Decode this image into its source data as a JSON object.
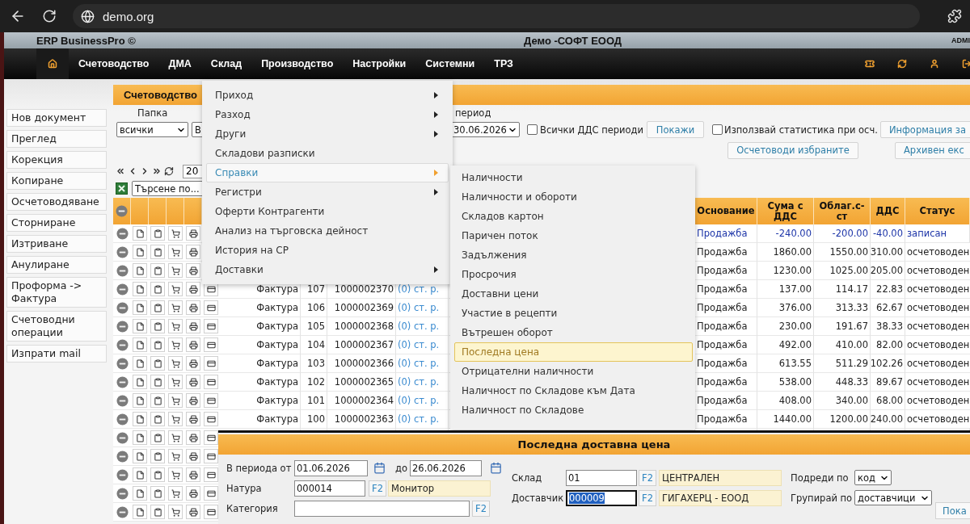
{
  "browser": {
    "url": "demo.org"
  },
  "app": {
    "name": "ERP BusinessPro ©",
    "company": "Демо -СОФТ ЕООД",
    "user": "ADMI"
  },
  "nav": {
    "items": [
      "Счетоводство",
      "ДМА",
      "Склад",
      "Производство",
      "Настройки",
      "Системни",
      "ТРЗ"
    ]
  },
  "sidebar": {
    "items": [
      "Нов документ",
      "Преглед",
      "Корекция",
      "Копиране",
      "Осчетоводяване",
      "Сторниране",
      "Изтриване",
      "Анулиране",
      "Проформа -> Фактура",
      "Счетоводни операции",
      "Изпрати mail"
    ]
  },
  "section_tab": "Счетоводство",
  "filters": {
    "folder_label": "Папка",
    "folder": "всички",
    "type": "В",
    "period_label": "период",
    "period": "30.06.2026",
    "checkboxes": [
      {
        "label": "Всички ДДС периоди",
        "checked": false
      },
      {
        "label": "Използвай статистика при осч.",
        "checked": false
      }
    ],
    "show_button": "Покажи",
    "info_button": "Информация за",
    "post_button": "Осчетоводи избраните",
    "archive_button": "Архивен екс"
  },
  "pager": {
    "page_size": "20",
    "search": "Търсене по..."
  },
  "table": {
    "columns": [
      "Основание",
      "Сума с ДДС",
      "Облаг.с-ст",
      "ДДС",
      "Статус"
    ],
    "rows": [
      {
        "kind": "right",
        "highlight": true,
        "basis": "Продажба",
        "total": "-240.00",
        "taxable": "-200.00",
        "vat": "-40.00",
        "status": "записан"
      },
      {
        "kind": "right",
        "highlight": false,
        "basis": "Продажба",
        "total": "1860.00",
        "taxable": "1550.00",
        "vat": "310.00",
        "status": "осчетоводен"
      },
      {
        "kind": "right",
        "highlight": false,
        "basis": "Продажба",
        "total": "1230.00",
        "taxable": "1025.00",
        "vat": "205.00",
        "status": "осчетоводен"
      },
      {
        "kind": "full",
        "highlight": false,
        "doc_type": "Фактура",
        "number": "107",
        "doc_no": "1000002370",
        "link": "(0) ст. р.",
        "basis": "Продажба",
        "total": "137.00",
        "taxable": "114.17",
        "vat": "22.83",
        "status": "осчетоводен"
      },
      {
        "kind": "full",
        "highlight": false,
        "doc_type": "Фактура",
        "number": "106",
        "doc_no": "1000002369",
        "link": "(0) ст. р.",
        "basis": "Продажба",
        "total": "376.00",
        "taxable": "313.33",
        "vat": "62.67",
        "status": "осчетоводен"
      },
      {
        "kind": "full",
        "highlight": false,
        "doc_type": "Фактура",
        "number": "105",
        "doc_no": "1000002368",
        "link": "(0) ст. р.",
        "basis": "Продажба",
        "total": "230.00",
        "taxable": "191.67",
        "vat": "38.33",
        "status": "осчетоводен"
      },
      {
        "kind": "full",
        "highlight": false,
        "doc_type": "Фактура",
        "number": "104",
        "doc_no": "1000002367",
        "link": "(0) ст. р.",
        "basis": "Продажба",
        "total": "492.00",
        "taxable": "410.00",
        "vat": "82.00",
        "status": "осчетоводен"
      },
      {
        "kind": "full",
        "highlight": false,
        "doc_type": "Фактура",
        "number": "103",
        "doc_no": "1000002366",
        "link": "(0) ст. р.",
        "basis": "Продажба",
        "total": "613.55",
        "taxable": "511.29",
        "vat": "102.26",
        "status": "осчетоводен"
      },
      {
        "kind": "full",
        "highlight": false,
        "doc_type": "Фактура",
        "number": "102",
        "doc_no": "1000002365",
        "link": "(0) ст. р.",
        "basis": "Продажба",
        "total": "538.00",
        "taxable": "448.33",
        "vat": "89.67",
        "status": "осчетоводен"
      },
      {
        "kind": "full",
        "highlight": false,
        "doc_type": "Фактура",
        "number": "101",
        "doc_no": "1000002364",
        "link": "(0) ст. р.",
        "basis": "Продажба",
        "total": "408.00",
        "taxable": "340.00",
        "vat": "68.00",
        "status": "осчетоводен"
      },
      {
        "kind": "full",
        "highlight": false,
        "doc_type": "Фактура",
        "number": "100",
        "doc_no": "1000002363",
        "link": "(0) ст. р.",
        "basis": "Продажба",
        "total": "1440.00",
        "taxable": "1200.00",
        "vat": "240.00",
        "status": "осчетоводен"
      },
      {
        "kind": "left"
      },
      {
        "kind": "left"
      },
      {
        "kind": "left"
      },
      {
        "kind": "left"
      },
      {
        "kind": "left"
      }
    ]
  },
  "menu": {
    "items": [
      {
        "label": "Приход",
        "submenu": true,
        "selected": false
      },
      {
        "label": "Разход",
        "submenu": true,
        "selected": false
      },
      {
        "label": "Други",
        "submenu": true,
        "selected": false
      },
      {
        "label": "Складови разписки",
        "submenu": false,
        "selected": false
      },
      {
        "label": "Справки",
        "submenu": true,
        "selected": true
      },
      {
        "label": "Регистри",
        "submenu": true,
        "selected": false
      },
      {
        "label": "Оферти Контрагенти",
        "submenu": false,
        "selected": false
      },
      {
        "label": "Анализ на търговска дейност",
        "submenu": false,
        "selected": false
      },
      {
        "label": "История на СР",
        "submenu": false,
        "selected": false
      },
      {
        "label": "Доставки",
        "submenu": true,
        "selected": false
      }
    ]
  },
  "submenu": {
    "items": [
      {
        "label": "Наличности",
        "selected": false
      },
      {
        "label": "Наличности и обороти",
        "selected": false
      },
      {
        "label": "Складов картон",
        "selected": false
      },
      {
        "label": "Паричен поток",
        "selected": false
      },
      {
        "label": "Задължения",
        "selected": false
      },
      {
        "label": "Просрочия",
        "selected": false
      },
      {
        "label": "Доставни цени",
        "selected": false
      },
      {
        "label": "Участие в рецепти",
        "selected": false
      },
      {
        "label": "Вътрешен оборот",
        "selected": false
      },
      {
        "label": "Последна цена",
        "selected": true
      },
      {
        "label": "Отрицателни наличности",
        "selected": false
      },
      {
        "label": "Наличност по Складове към Дата",
        "selected": false
      },
      {
        "label": "Наличност по Складове",
        "selected": false
      }
    ]
  },
  "dialog": {
    "title": "Последна доставна цена",
    "period": {
      "label": "В периода от",
      "from": "01.06.2026",
      "to_label": "до",
      "to": "26.06.2026"
    },
    "item": {
      "label": "Натура",
      "code": "000014",
      "lookup": "F2",
      "name": "Монитор"
    },
    "category": {
      "label": "Категория",
      "lookup": "F2"
    },
    "lookups": [
      {
        "label": "Склад",
        "code": "01",
        "lookup": "F2",
        "name": "ЦЕНТРАЛЕН",
        "focused": false
      },
      {
        "label": "Доставчик",
        "code": "000009",
        "lookup": "F2",
        "name": "ГИГАХЕРЦ - ЕООД",
        "focused": true
      }
    ],
    "options": [
      {
        "label": "Подреди по",
        "value": "код"
      },
      {
        "label": "Групирай по",
        "value": "доставчици"
      }
    ],
    "button": "Пока"
  }
}
